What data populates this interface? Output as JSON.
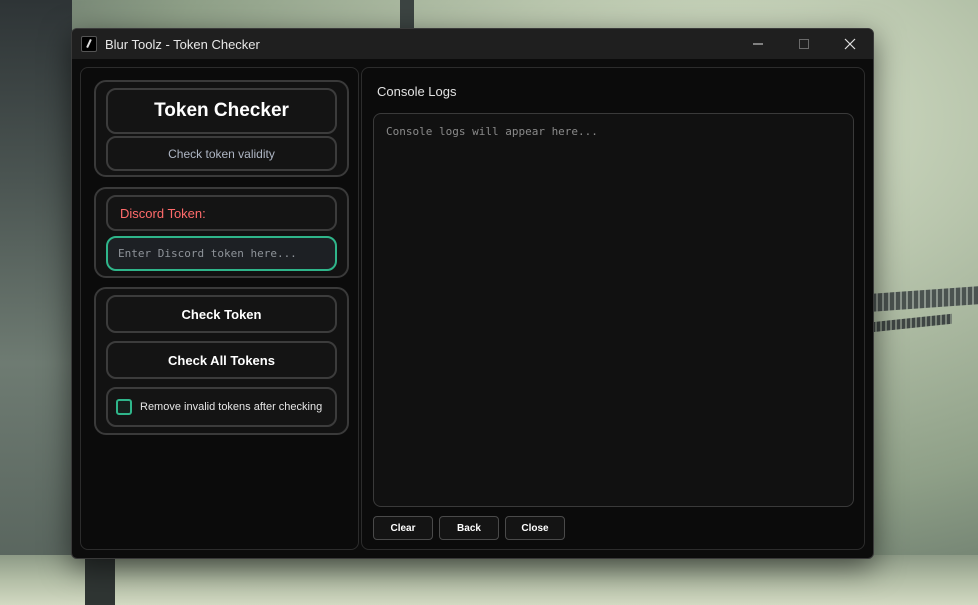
{
  "window": {
    "title": "Blur Toolz - Token Checker"
  },
  "header": {
    "title": "Token Checker",
    "subtitle": "Check token validity"
  },
  "token_input": {
    "label": "Discord Token:",
    "placeholder": "Enter Discord token here...",
    "value": ""
  },
  "actions": {
    "check_token": "Check Token",
    "check_all": "Check All Tokens",
    "remove_invalid_label": "Remove invalid tokens after checking",
    "remove_invalid_checked": false
  },
  "console": {
    "title": "Console Logs",
    "placeholder": "Console logs will appear here...",
    "buttons": {
      "clear": "Clear",
      "back": "Back",
      "close": "Close"
    }
  },
  "colors": {
    "accent": "#2fb58a",
    "label_red": "#ff6b6b",
    "background": "#0b0b0b"
  },
  "icons": {
    "app": "app-icon",
    "minimize": "minimize-icon",
    "maximize": "maximize-icon",
    "close": "close-icon"
  }
}
